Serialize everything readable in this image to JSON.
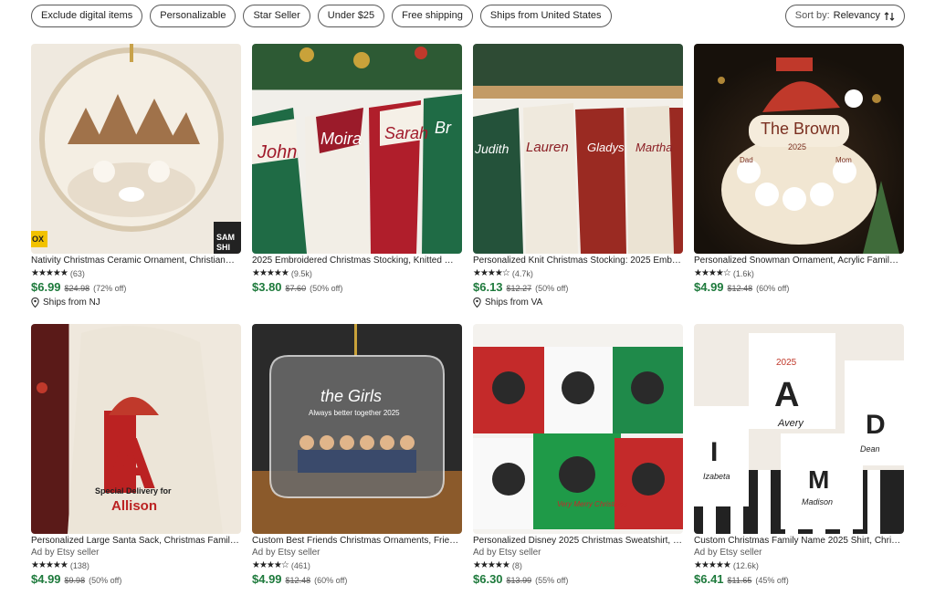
{
  "filters": [
    "Exclude digital items",
    "Personalizable",
    "Star Seller",
    "Under $25",
    "Free shipping",
    "Ships from United States"
  ],
  "sort": {
    "label": "Sort by:",
    "value": "Relevancy",
    "icon": "sort-arrows-icon"
  },
  "listings": [
    {
      "title": "Nativity Christmas Ceramic Ornament, Christian…",
      "ad": "",
      "stars": "★★★★★",
      "reviews": "(63)",
      "price": "$6.99",
      "original": "$24.98",
      "discount": "(72% off)",
      "ships": "Ships from NJ",
      "image_text": [
        "SAM",
        "SHI",
        "OX"
      ]
    },
    {
      "title": "2025 Embroidered Christmas Stocking, Knitted …",
      "ad": "",
      "stars": "★★★★★",
      "reviews": "(9.5k)",
      "price": "$3.80",
      "original": "$7.60",
      "discount": "(50% off)",
      "ships": "",
      "image_text": [
        "John",
        "Moira",
        "Sarah",
        "Br"
      ]
    },
    {
      "title": "Personalized Knit Christmas Stocking: 2025 Emb…",
      "ad": "",
      "stars": "★★★★☆",
      "reviews": "(4.7k)",
      "price": "$6.13",
      "original": "$12.27",
      "discount": "(50% off)",
      "ships": "Ships from VA",
      "image_text": [
        "Judith",
        "Lauren",
        "Gladys",
        "Martha"
      ]
    },
    {
      "title": "Personalized Snowman Ornament, Acrylic Famil…",
      "ad": "",
      "stars": "★★★★☆",
      "reviews": "(1.6k)",
      "price": "$4.99",
      "original": "$12.48",
      "discount": "(60% off)",
      "ships": "",
      "image_text": [
        "The Brown",
        "2025",
        "Dad",
        "Mom"
      ]
    },
    {
      "title": "Personalized Large Santa Sack, Christmas Famil…",
      "ad": "Ad by Etsy seller",
      "stars": "★★★★★",
      "reviews": "(138)",
      "price": "$4.99",
      "original": "$9.98",
      "discount": "(50% off)",
      "ships": "",
      "image_text": [
        "A",
        "Special Delivery for",
        "Allison"
      ]
    },
    {
      "title": "Custom Best Friends Christmas Ornaments, Frie…",
      "ad": "Ad by Etsy seller",
      "stars": "★★★★☆",
      "reviews": "(461)",
      "price": "$4.99",
      "original": "$12.48",
      "discount": "(60% off)",
      "ships": "",
      "image_text": [
        "the Girls",
        "Always better together 2025"
      ]
    },
    {
      "title": "Personalized Disney 2025 Christmas Sweatshirt, …",
      "ad": "Ad by Etsy seller",
      "stars": "★★★★★",
      "reviews": "(8)",
      "price": "$6.30",
      "original": "$13.99",
      "discount": "(55% off)",
      "ships": "",
      "image_text": [
        "Very Merry Christmas"
      ]
    },
    {
      "title": "Custom Christmas Family Name 2025 Shirt, Chri…",
      "ad": "Ad by Etsy seller",
      "stars": "★★★★★",
      "reviews": "(12.6k)",
      "price": "$6.41",
      "original": "$11.65",
      "discount": "(45% off)",
      "ships": "",
      "image_text": [
        "2025",
        "A",
        "Avery",
        "D",
        "Dean",
        "I",
        "Izabeta",
        "M",
        "Madison"
      ]
    }
  ]
}
